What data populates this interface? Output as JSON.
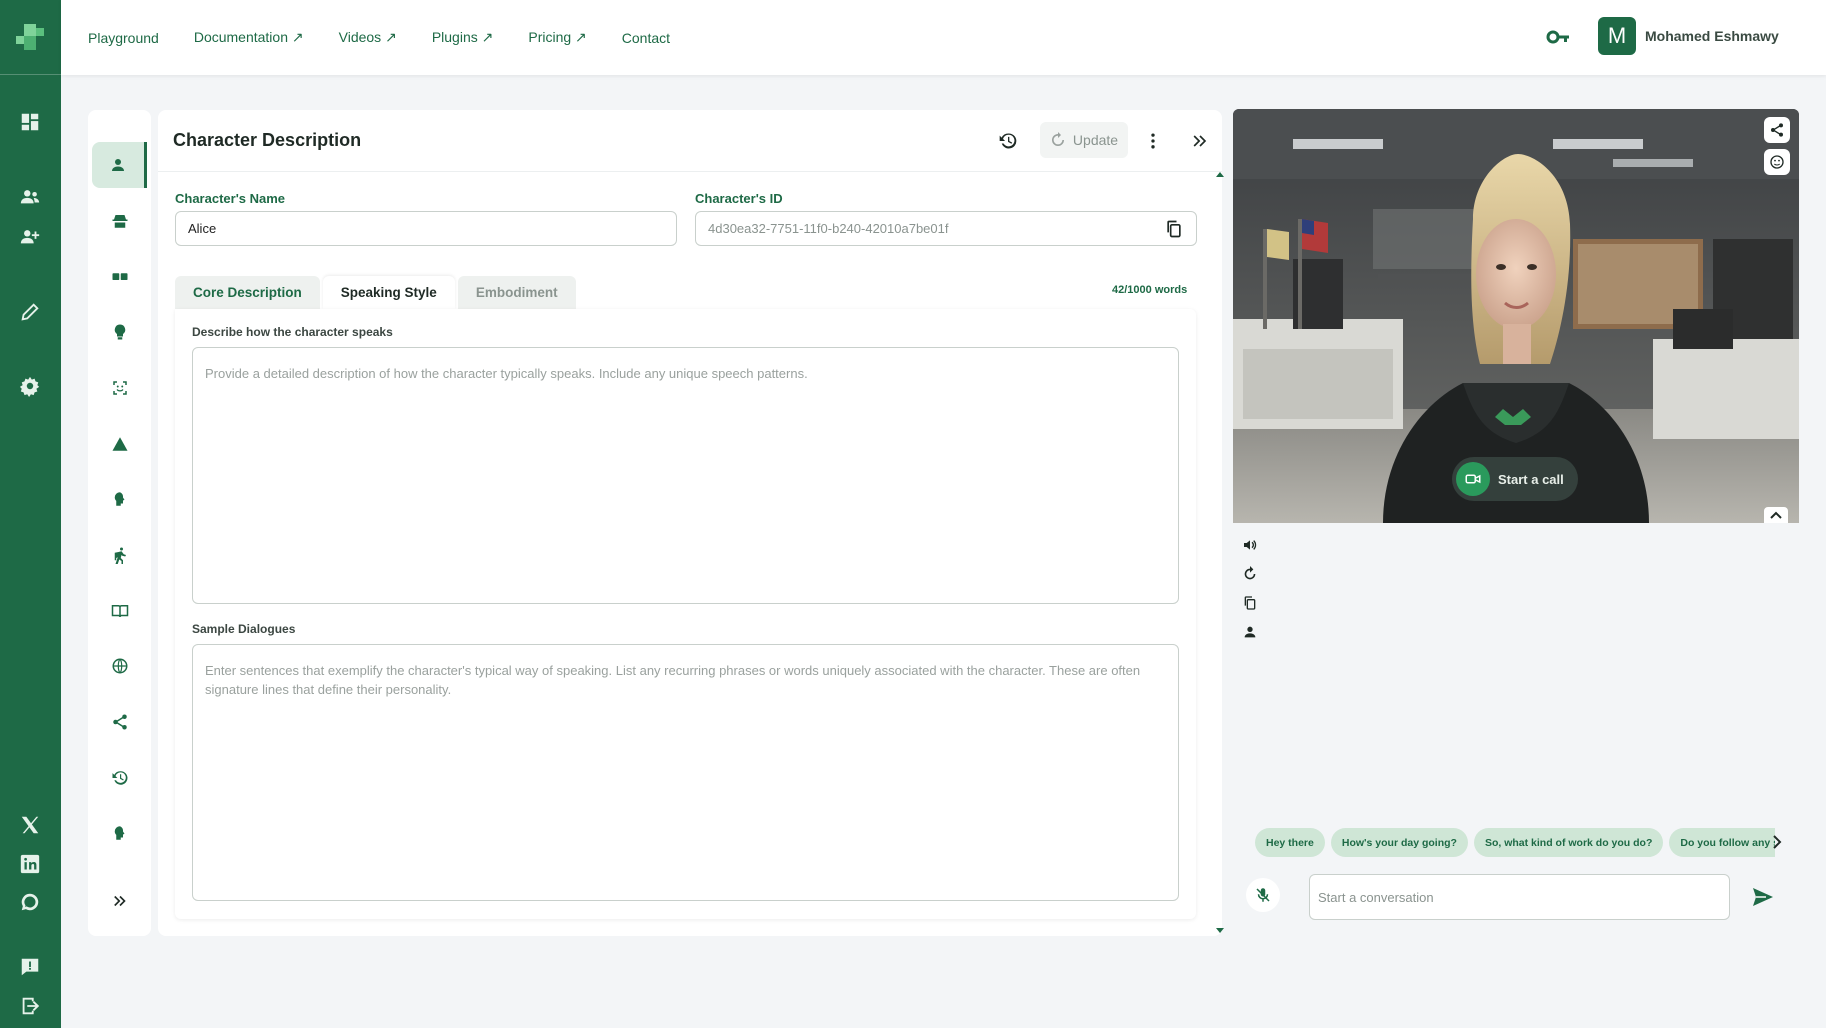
{
  "nav": {
    "items": [
      "Playground",
      "Documentation ↗",
      "Videos ↗",
      "Plugins ↗",
      "Pricing ↗",
      "Contact"
    ]
  },
  "user": {
    "initial": "M",
    "name": "Mohamed Eshmawy"
  },
  "panel": {
    "title": "Character Description",
    "update_label": "Update"
  },
  "fields": {
    "name_label": "Character's Name",
    "name_value": "Alice",
    "id_label": "Character's ID",
    "id_value": "4d30ea32-7751-11f0-b240-42010a7be01f"
  },
  "tabs": [
    "Core Description",
    "Speaking Style",
    "Embodiment"
  ],
  "wordcount": "42/1000 words",
  "speaking": {
    "label": "Describe how the character speaks",
    "placeholder": "Provide a detailed description of how the character typically speaks. Include any unique speech patterns.",
    "dialogues_label": "Sample Dialogues",
    "dialogues_placeholder": "Enter sentences that exemplify the character's typical way of speaking. List any recurring phrases or words uniquely associated with the character. These are often signature lines that define their personality."
  },
  "preview": {
    "call_label": "Start a call",
    "chips": [
      "Hey there",
      "How's your day going?",
      "So, what kind of work do you do?",
      "Do you follow any sports?"
    ],
    "chat_placeholder": "Start a conversation"
  },
  "colors": {
    "brand": "#1e6a46",
    "brand_light": "#cfe6d6",
    "background": "#f3f5f7"
  }
}
